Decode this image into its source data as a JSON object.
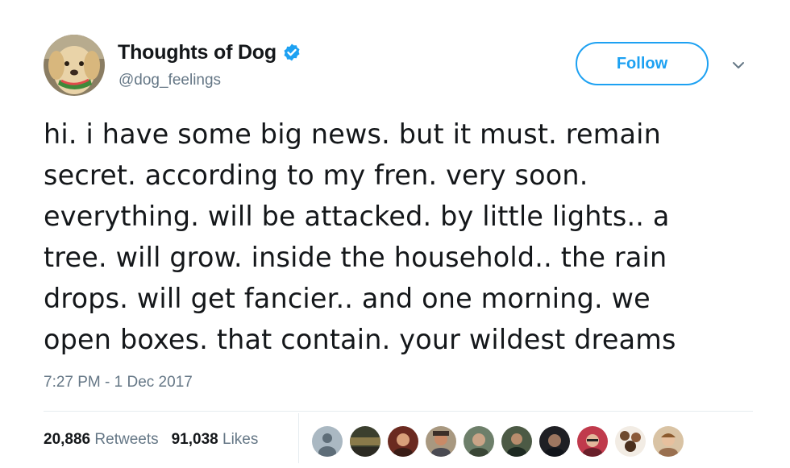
{
  "user": {
    "display_name": "Thoughts of Dog",
    "handle": "@dog_feelings",
    "verified_icon": "verified-badge-icon"
  },
  "actions": {
    "follow_label": "Follow",
    "more_icon": "chevron-down-icon"
  },
  "tweet": {
    "lines": [
      "hi. i have some big news. but it must. remain",
      "secret. according to my fren. very soon.",
      "everything. will be attacked. by little lights.. a",
      "tree. will grow. inside the household.. the rain",
      "drops. will get fancier.. and one morning. we",
      "open boxes. that contain. your wildest dreams"
    ],
    "timestamp": "7:27 PM - 1 Dec 2017"
  },
  "stats": {
    "retweets_count": "20,886",
    "retweets_label": "Retweets",
    "likes_count": "91,038",
    "likes_label": "Likes"
  },
  "colors": {
    "accent": "#1da1f2",
    "text": "#14171a",
    "secondary": "#657786",
    "divider": "#e6ecf0"
  }
}
